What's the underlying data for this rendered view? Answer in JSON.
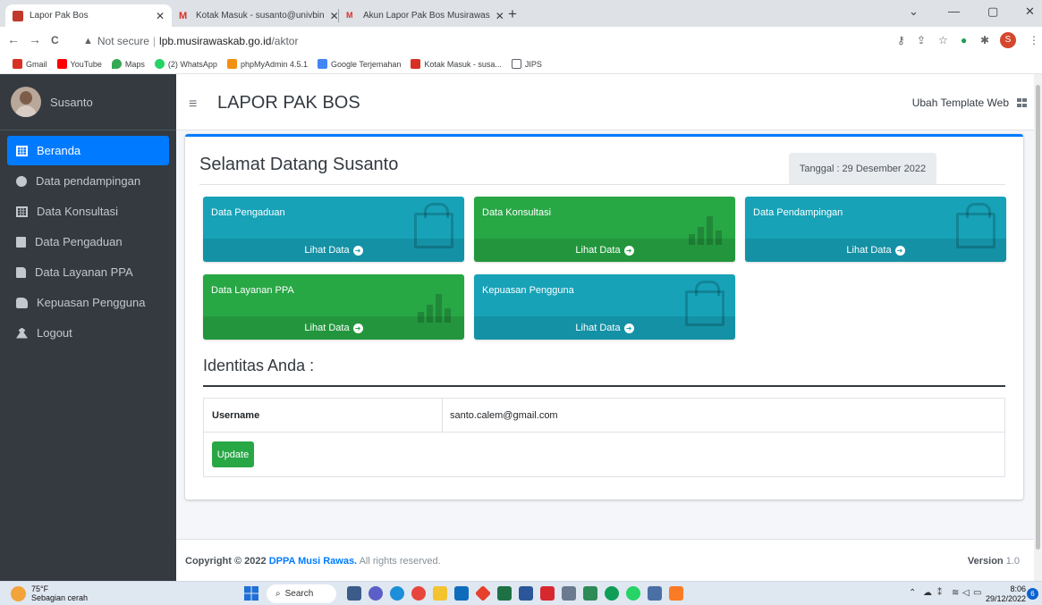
{
  "browser": {
    "tabs": [
      {
        "title": "Lapor Pak Bos",
        "close": "✕"
      },
      {
        "title": "Kotak Masuk - susanto@univbin",
        "close": "✕"
      },
      {
        "title": "Akun Lapor Pak Bos Musirawas",
        "close": "✕"
      }
    ],
    "new_tab": "+",
    "controls": {
      "minimize": "—",
      "maximize": "▢",
      "close": "✕",
      "dropdown": "⌄"
    },
    "nav": {
      "back": "←",
      "forward": "→",
      "reload": "C"
    },
    "address": {
      "warning": "▲",
      "not_secure": "Not secure",
      "separator": "|",
      "host": "lpb.musirawaskab.go.id",
      "path": "/aktor"
    },
    "profile_initial": "S",
    "bookmarks": [
      {
        "label": "Gmail",
        "color": "#d93025"
      },
      {
        "label": "YouTube",
        "color": "#ff0000"
      },
      {
        "label": "Maps",
        "color": "#34a853"
      },
      {
        "label": "(2) WhatsApp",
        "color": "#25d366"
      },
      {
        "label": "phpMyAdmin 4.5.1",
        "color": "#f29111"
      },
      {
        "label": "Google Terjemahan",
        "color": "#4285f4"
      },
      {
        "label": "Kotak Masuk - susa...",
        "color": "#d93025"
      },
      {
        "label": "JIPS",
        "color": "#5f6368"
      }
    ]
  },
  "sidebar": {
    "user": "Susanto",
    "items": [
      {
        "label": "Beranda",
        "icon": "grid-icon",
        "active": true
      },
      {
        "label": "Data pendampingan",
        "icon": "circle-icon"
      },
      {
        "label": "Data Konsultasi",
        "icon": "grid-icon"
      },
      {
        "label": "Data Pengaduan",
        "icon": "copy-icon"
      },
      {
        "label": "Data Layanan PPA",
        "icon": "file-icon"
      },
      {
        "label": "Kepuasan Pengguna",
        "icon": "thumbs-up-icon"
      },
      {
        "label": "Logout",
        "icon": "user-icon"
      }
    ]
  },
  "header": {
    "menu_icon": "≡",
    "title": "LAPOR PAK BOS",
    "template_link": "Ubah Template Web"
  },
  "main": {
    "welcome": "Selamat Datang Susanto",
    "date": "Tanggal : 29 Desember 2022",
    "boxes": [
      {
        "title": "Data Pengaduan",
        "link": "Lihat Data",
        "color": "#17a2b8",
        "icon": "shopping-bag-icon"
      },
      {
        "title": "Data Konsultasi",
        "link": "Lihat Data",
        "color": "#28a745",
        "icon": "bar-chart-icon"
      },
      {
        "title": "Data Pendampingan",
        "link": "Lihat Data",
        "color": "#17a2b8",
        "icon": "shopping-bag-icon"
      },
      {
        "title": "Data Layanan PPA",
        "link": "Lihat Data",
        "color": "#28a745",
        "icon": "bar-chart-icon"
      },
      {
        "title": "Kepuasan Pengguna",
        "link": "Lihat Data",
        "color": "#17a2b8",
        "icon": "shopping-bag-icon"
      }
    ],
    "arrow": "➜",
    "identity_title": "Identitas Anda :",
    "identity": {
      "label": "Username",
      "value": "santo.calem@gmail.com"
    },
    "update_button": "Update"
  },
  "footer": {
    "copyright_prefix": "Copyright © 2022",
    "brand": "DPPA Musi Rawas.",
    "rights": "All rights reserved.",
    "version_label": "Version",
    "version": "1.0"
  },
  "taskbar": {
    "temperature": "75°F",
    "weather": "Sebagian cerah",
    "search": "Search",
    "time": "8:06",
    "date": "29/12/2022",
    "notifications": "6",
    "tray": "⌃"
  }
}
